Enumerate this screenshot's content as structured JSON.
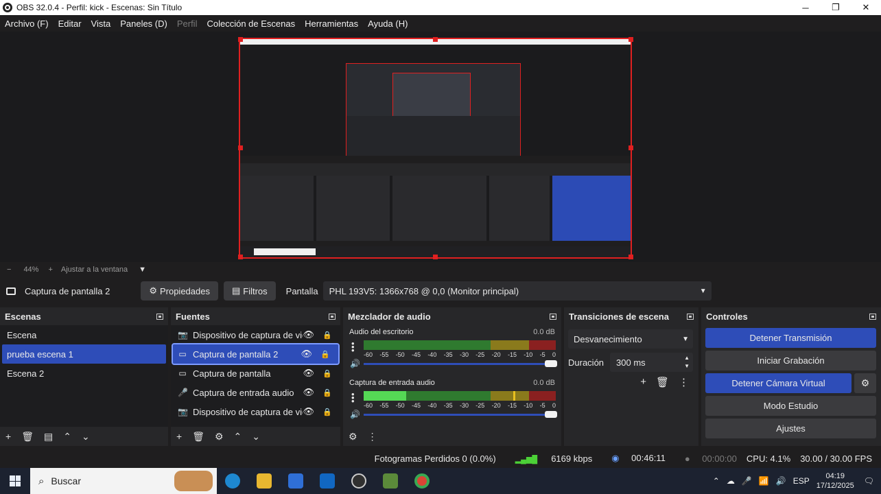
{
  "window": {
    "title": "OBS 32.0.4 - Perfil: kick - Escenas: Sin Título",
    "minimize": "─",
    "maximize": "❐",
    "close": "✕"
  },
  "menu": {
    "archivo": "Archivo (F)",
    "editar": "Editar",
    "vista": "Vista",
    "paneles": "Paneles (D)",
    "perfil": "Perfil",
    "coleccion": "Colección de Escenas",
    "herramientas": "Herramientas",
    "ayuda": "Ayuda (H)"
  },
  "zoom": {
    "minus": "−",
    "level": "44%",
    "plus": "+",
    "fit": "Ajustar a la ventana",
    "chevron": "▼"
  },
  "properties_bar": {
    "source_name": "Captura de pantalla 2",
    "properties_label": "Propiedades",
    "filters_label": "Filtros",
    "display_label": "Pantalla",
    "display_value": "PHL 193V5: 1366x768 @ 0,0 (Monitor principal)"
  },
  "scenes": {
    "header": "Escenas",
    "items": [
      "Escena",
      "prueba escena 1",
      "Escena 2"
    ],
    "selected_index": 1
  },
  "sources": {
    "header": "Fuentes",
    "items": [
      {
        "label": "Dispositivo de captura de vid",
        "icon": "camera-icon"
      },
      {
        "label": "Captura de pantalla 2",
        "icon": "monitor-icon"
      },
      {
        "label": "Captura de pantalla",
        "icon": "monitor-icon"
      },
      {
        "label": "Captura de entrada audio",
        "icon": "microphone-icon"
      },
      {
        "label": "Dispositivo de captura de vid",
        "icon": "camera-icon"
      }
    ],
    "selected_index": 1
  },
  "mixer": {
    "header": "Mezclador de audio",
    "ticks": [
      "-60",
      "-55",
      "-50",
      "-45",
      "-40",
      "-35",
      "-30",
      "-25",
      "-20",
      "-15",
      "-10",
      "-5",
      "0"
    ],
    "channels": [
      {
        "name": "Audio del escritorio",
        "level": "0.0 dB",
        "meter_fill": 0.0,
        "volume": 1.0
      },
      {
        "name": "Captura de entrada audio",
        "level": "0.0 dB",
        "meter_fill": 0.22,
        "volume": 1.0
      }
    ]
  },
  "transitions": {
    "header": "Transiciones de escena",
    "selected": "Desvanecimiento",
    "duration_label": "Duración",
    "duration_value": "300 ms"
  },
  "controls": {
    "header": "Controles",
    "stop_stream": "Detener Transmisión",
    "start_recording": "Iniciar Grabación",
    "stop_virtual_cam": "Detener Cámara Virtual",
    "studio_mode": "Modo Estudio",
    "settings": "Ajustes"
  },
  "status": {
    "dropped_frames": "Fotogramas Perdidos 0 (0.0%)",
    "bitrate": "6169 kbps",
    "stream_time": "00:46:11",
    "rec_time": "00:00:00",
    "cpu": "CPU: 4.1%",
    "fps": "30.00 / 30.00 FPS"
  },
  "taskbar": {
    "search_placeholder": "Buscar",
    "lang": "ESP",
    "time": "04:19",
    "date": "17/12/2025"
  },
  "colors": {
    "accent_blue": "#2e4db8",
    "selection_red": "#e02020",
    "meter_green": "#3db23d",
    "meter_yellow": "#c8a21c",
    "meter_red": "#b52424"
  }
}
